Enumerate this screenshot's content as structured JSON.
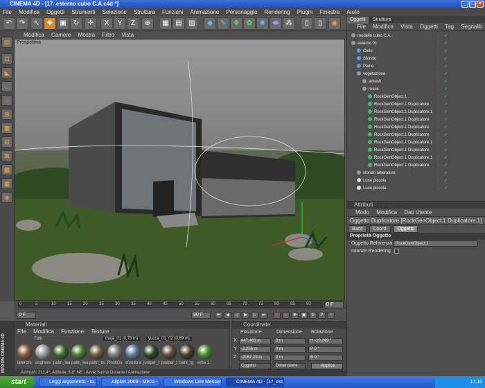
{
  "window": {
    "title": "CINEMA 4D - [17_esterno cubo C.A.c4d *]"
  },
  "menubar": [
    "File",
    "Modifica",
    "Oggetti",
    "Strumenti",
    "Selezione",
    "Struttura",
    "Funzioni",
    "Animazione",
    "Personaggio",
    "Rendering",
    "Plugin",
    "Finestre",
    "Aiuto"
  ],
  "viewport": {
    "menu": [
      "Modifica",
      "Camere",
      "Mostra",
      "Filtro",
      "Vista"
    ],
    "label": "Prospettiva"
  },
  "timeline": {
    "ticks": [
      "0",
      "5",
      "10",
      "15",
      "20",
      "25",
      "30",
      "35",
      "40",
      "45",
      "50",
      "55",
      "60",
      "65",
      "70",
      "75",
      "80",
      "85",
      "90"
    ],
    "end_label": "0 F"
  },
  "transport": {
    "start": "0 F",
    "end": "90 F"
  },
  "materials": {
    "header": "Materiali",
    "menu": [
      "File",
      "Modifica",
      "Funzione",
      "Texture"
    ],
    "filter": "Tutti",
    "tags": [
      "thuja_01 (0.78 m)",
      "yucca_01_02 (0.69 m)"
    ],
    "items": [
      {
        "name": "laterizio",
        "color": "#8a5a3a"
      },
      {
        "name": "anghera",
        "color": "#9a9a9a"
      },
      {
        "name": "palm_lea",
        "color": "#3a6a2a"
      },
      {
        "name": "palm_lea",
        "color": "#4a7a2a"
      },
      {
        "name": "palm_tru",
        "color": "#6a5a3a"
      },
      {
        "name": "RockGe",
        "color": "#7a7a7a"
      },
      {
        "name": "sfondo a",
        "color": "#5a7a9a"
      },
      {
        "name": "juniper_f",
        "color": "#2a4a2a"
      },
      {
        "name": "juniper_t",
        "color": "#5a4a3a"
      },
      {
        "name": "bark_rg",
        "color": "#4a3a2a"
      },
      {
        "name": "erba 1",
        "color": "#4a8a2a"
      }
    ]
  },
  "coords": {
    "header": "Coordinate",
    "cols": [
      "Posizione",
      "Dimensione",
      "Rotazione"
    ],
    "rows": [
      {
        "axis": "X",
        "pos": "447.463 m",
        "dim": "0 m",
        "rot": "H -10.249 °"
      },
      {
        "axis": "Y",
        "pos": "-2.256 m",
        "dim": "0 m",
        "rot": "P 0 °"
      },
      {
        "axis": "Z",
        "pos": "-2057.29 m",
        "dim": "0 m",
        "rot": "B 0 °"
      }
    ],
    "mode1": "Oggetto",
    "mode2": "Dimensione",
    "apply": "Applica"
  },
  "objects": {
    "tabs": [
      "Oggetti",
      "Struttura"
    ],
    "menu": [
      "File",
      "Modifica",
      "Vista",
      "Oggetti",
      "Tag",
      "Segnalib"
    ],
    "rows": [
      {
        "name": "modello cubo C.A.",
        "indent": 0,
        "color": "#9a9a9a"
      },
      {
        "name": "esterno 01",
        "indent": 0,
        "color": "#9a9a9a"
      },
      {
        "name": "Cielo",
        "indent": 1,
        "color": "#5aa0e0"
      },
      {
        "name": "Sfondo",
        "indent": 1,
        "color": "#5aa0e0"
      },
      {
        "name": "Piano",
        "indent": 1,
        "color": "#5aa0e0"
      },
      {
        "name": "vegetazione",
        "indent": 1,
        "color": "#9a9a9a"
      },
      {
        "name": "arbusti",
        "indent": 2,
        "color": "#9a9a9a"
      },
      {
        "name": "rocce",
        "indent": 2,
        "color": "#9a9a9a"
      },
      {
        "name": "RockGenObject.1",
        "indent": 3,
        "color": "#3ac06a"
      },
      {
        "name": "RockGenObject.1 Duplicatore",
        "indent": 3,
        "color": "#3ac06a"
      },
      {
        "name": "RockGenObject.1 Duplicatore.1",
        "indent": 3,
        "color": "#3ac06a"
      },
      {
        "name": "RockGenObject.1 Duplicatore",
        "indent": 3,
        "color": "#3ac06a"
      },
      {
        "name": "RockGenObject.1 Duplicatore",
        "indent": 3,
        "color": "#3ac06a"
      },
      {
        "name": "RockGenObject.1 Duplicatore",
        "indent": 3,
        "color": "#3ac06a"
      },
      {
        "name": "RockGenObject.1 Duplicatore.1",
        "indent": 3,
        "color": "#3ac06a"
      },
      {
        "name": "RockGenObject.1 Duplicatore",
        "indent": 3,
        "color": "#3ac06a"
      },
      {
        "name": "RockGenObject.1 Duplicatore.1",
        "indent": 3,
        "color": "#3ac06a"
      },
      {
        "name": "RockGenObject.1 Duplicatore",
        "indent": 3,
        "color": "#3ac06a"
      },
      {
        "name": "sfondo alberature",
        "indent": 1,
        "color": "#9a9a9a"
      },
      {
        "name": "Luce piccola",
        "indent": 1,
        "color": "#e0e0e0"
      },
      {
        "name": "Luce piccola",
        "indent": 1,
        "color": "#e0e0e0"
      }
    ]
  },
  "attributes": {
    "header": "Attributi",
    "menu": [
      "Modo",
      "Modifica",
      "Dati Utente"
    ],
    "title": "Oggetto Duplicatore [RockGenObject.1 Duplicatore.1]",
    "tabs": [
      "Base",
      "Coord.",
      "Oggetto"
    ],
    "section": "Proprietà Oggetto",
    "ref_label": "Oggetto Referenza",
    "ref_value": "RockGenObject.1",
    "rendering_label": "Istanze Rendering"
  },
  "statusbar": "Azimuth: 211.4°, Altitude: 6.8° NE : Avvia Suono Durante l'Animazione",
  "maxon": "MAXON CINEMA 4D",
  "taskbar": {
    "start": "start",
    "tasks": [
      "Leggi argomento - to...",
      "Allplan 2009 - Mirco -...",
      "Windows Live Messen...",
      "CINEMA 4D - [17_est..."
    ],
    "clock": "17.10"
  }
}
